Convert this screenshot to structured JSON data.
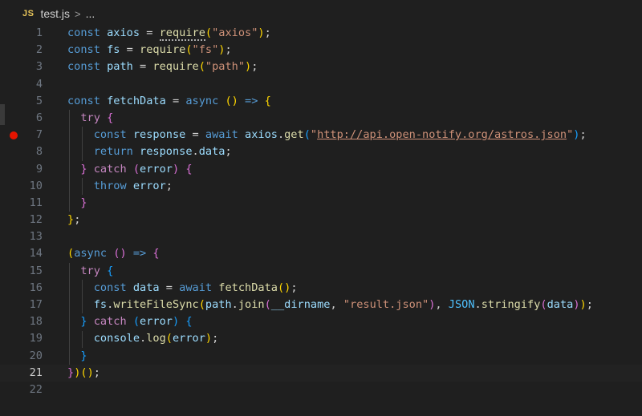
{
  "breadcrumb": {
    "icon_text": "JS",
    "file_name": "test.js",
    "separator": ">",
    "ellipsis": "..."
  },
  "editor": {
    "current_line": 21,
    "breakpoint_line": 7,
    "line_numbers": [
      "1",
      "2",
      "3",
      "4",
      "5",
      "6",
      "7",
      "8",
      "9",
      "10",
      "11",
      "12",
      "13",
      "14",
      "15",
      "16",
      "17",
      "18",
      "19",
      "20",
      "21",
      "22"
    ],
    "lines": [
      "const axios = require(\"axios\");",
      "const fs = require(\"fs\");",
      "const path = require(\"path\");",
      "",
      "const fetchData = async () => {",
      "  try {",
      "    const response = await axios.get(\"http://api.open-notify.org/astros.json\");",
      "    return response.data;",
      "  } catch (error) {",
      "    throw error;",
      "  }",
      "};",
      "",
      "(async () => {",
      "  try {",
      "    const data = await fetchData();",
      "    fs.writeFileSync(path.join(__dirname, \"result.json\"), JSON.stringify(data));",
      "  } catch (error) {",
      "    console.log(error);",
      "  }",
      "})();",
      ""
    ]
  },
  "colors": {
    "background": "#1f1f1f",
    "breakpoint": "#e51400",
    "keyword": "#569cd6",
    "variable": "#9cdcfe",
    "function": "#dcdcaa",
    "string": "#ce9178",
    "control": "#c586c0"
  }
}
